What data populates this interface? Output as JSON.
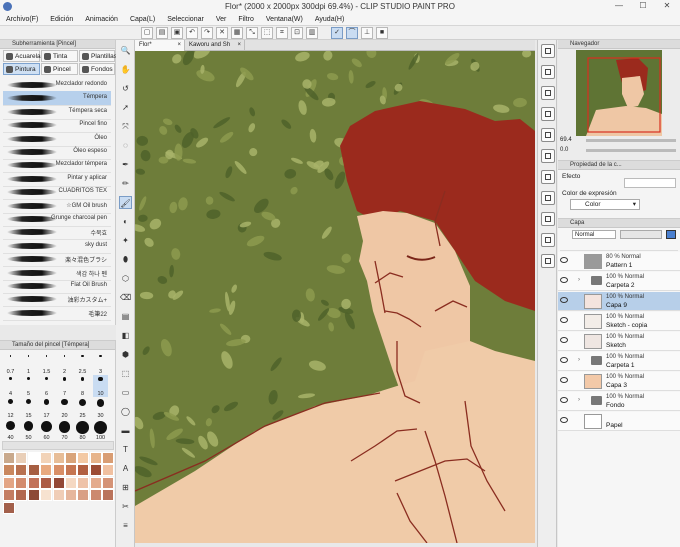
{
  "window": {
    "title": "Flor* (2000 x 2000px 300dpi 69.4%) - CLIP STUDIO PAINT PRO",
    "controls": [
      "—",
      "☐",
      "✕"
    ]
  },
  "menu": [
    "Archivo(F)",
    "Edición",
    "Animación",
    "Capa(L)",
    "Seleccionar",
    "Ver",
    "Filtro",
    "Ventana(W)",
    "Ayuda(H)"
  ],
  "subtool": {
    "header": "Subherramienta [Pincel]",
    "groups": [
      {
        "label": "Acuarela",
        "selected": false
      },
      {
        "label": "Tinta",
        "selected": false
      },
      {
        "label": "Plantillas",
        "selected": false
      },
      {
        "label": "Pintura",
        "selected": true
      },
      {
        "label": "Pincel",
        "selected": false
      },
      {
        "label": "Fondos",
        "selected": false
      }
    ],
    "brushes": [
      {
        "name": "Mezclador redondo",
        "selected": false
      },
      {
        "name": "Témpera",
        "selected": true
      },
      {
        "name": "Témpera seca",
        "selected": false
      },
      {
        "name": "Pincel fino",
        "selected": false
      },
      {
        "name": "Óleo",
        "selected": false
      },
      {
        "name": "Óleo espeso",
        "selected": false
      },
      {
        "name": "Mezclador témpera",
        "selected": false
      },
      {
        "name": "Pintar y aplicar",
        "selected": false
      },
      {
        "name": "CUADRITOS TEX",
        "selected": false
      },
      {
        "name": "☆GM Oil brush",
        "selected": false
      },
      {
        "name": "Grunge charcoal pen",
        "selected": false
      },
      {
        "name": "수묵효",
        "selected": false
      },
      {
        "name": "sky dust",
        "selected": false
      },
      {
        "name": "楽々混色ブラシ",
        "selected": false
      },
      {
        "name": "색감 하나 펜",
        "selected": false
      },
      {
        "name": "Flat Oil Brush",
        "selected": false
      },
      {
        "name": "油彩カスタム+",
        "selected": false
      },
      {
        "name": "毛筆22",
        "selected": false
      }
    ]
  },
  "brush_size": {
    "header": "Tamaño del pincel [Témpera]",
    "sizes": [
      "0.7",
      "1",
      "1.5",
      "2",
      "2.5",
      "3",
      "4",
      "5",
      "6",
      "7",
      "8",
      "10",
      "12",
      "15",
      "17",
      "20",
      "25",
      "30",
      "40",
      "50",
      "60",
      "70",
      "80",
      "100"
    ],
    "selected": "10"
  },
  "color_set": {
    "swatches": [
      "#c9a98c",
      "#e9cfb8",
      "#ffffff",
      "#f2d3b8",
      "#e7bd97",
      "#d9a47a",
      "#f3c9a4",
      "#e7b48a",
      "#d99d73",
      "#c9875e",
      "#b87150",
      "#a65e42",
      "#e8a97f",
      "#d88e66",
      "#c57652",
      "#b15f41",
      "#9c4c34",
      "#f0c0a0",
      "#e3a585",
      "#d38b6d",
      "#c27259",
      "#ac5c46",
      "#934836",
      "#f5d8c2",
      "#eec2a8",
      "#e4ab8d",
      "#d59376",
      "#c47d62",
      "#b2684f",
      "#8d4a36",
      "#f7e2d0",
      "#f0cdb6",
      "#e6b69c",
      "#d99f85",
      "#cc896f",
      "#ba735b",
      "#a25f4a"
    ]
  },
  "tool_palette": [
    "🔍",
    "✋",
    "↺",
    "➚",
    "⤧",
    "◌",
    "✒",
    "✏",
    "🖌",
    "◐",
    "✦",
    "⬮",
    "⬡",
    "⌫",
    "▤",
    "◧",
    "⬢",
    "⬚",
    "▭",
    "◯",
    "▬",
    "T",
    "A",
    "⊞",
    "✂",
    "≡"
  ],
  "canvas_tabs": [
    {
      "label": "Flor*",
      "active": true
    },
    {
      "label": "Kaworu and Sh",
      "active": false
    }
  ],
  "navigator": {
    "header": "Navegador",
    "zoom": "69.4",
    "angle": "0.0"
  },
  "property": {
    "header": "Propiedad de la c...",
    "effect_label": "Efecto",
    "color_expr_label": "Color de expresión",
    "color_expr_value": "Color"
  },
  "layer": {
    "header": "Capa",
    "blend_mode": "Normal",
    "opacity": "100",
    "items": [
      {
        "line1": "80 % Normal",
        "line2": "Pattern 1",
        "type": "layer",
        "selected": false,
        "thumb": "#9a9a9a"
      },
      {
        "line1": "100 % Normal",
        "line2": "Carpeta 2",
        "type": "folder",
        "selected": false,
        "thumb": ""
      },
      {
        "line1": "100 % Normal",
        "line2": "Capa 9",
        "type": "layer",
        "selected": true,
        "thumb": "#f4e4de"
      },
      {
        "line1": "100 % Normal",
        "line2": "Sketch - copia",
        "type": "layer",
        "selected": false,
        "thumb": "#f3ede8"
      },
      {
        "line1": "100 % Normal",
        "line2": "Sketch",
        "type": "layer",
        "selected": false,
        "thumb": "#efe6e2"
      },
      {
        "line1": "100 % Normal",
        "line2": "Carpeta 1",
        "type": "folder",
        "selected": false,
        "thumb": ""
      },
      {
        "line1": "100 % Normal",
        "line2": "Capa 3",
        "type": "layer",
        "selected": false,
        "thumb": "#f3c9a8"
      },
      {
        "line1": "100 % Normal",
        "line2": "Fondo",
        "type": "folder",
        "selected": false,
        "thumb": ""
      },
      {
        "line1": "",
        "line2": "Papel",
        "type": "layer",
        "selected": false,
        "thumb": "#ffffff"
      }
    ]
  },
  "canvas_palette": {
    "foliage": "#6d7c39",
    "foliage_light": "#a9b468",
    "skin": "#efc9a6",
    "hair": "#9b2a1d",
    "line": "#8a2d20"
  }
}
